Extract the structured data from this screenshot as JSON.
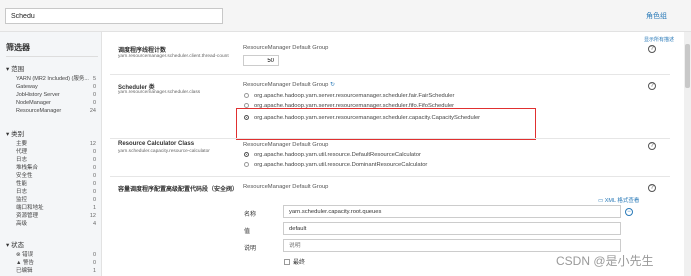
{
  "search": {
    "value": "Schedu"
  },
  "header": {
    "role_filter": "角色组"
  },
  "sidebar": {
    "title": "筛选器",
    "sections": [
      {
        "label": "范围",
        "items": [
          {
            "label": "YARN (MR2 Included) (服务...",
            "count": "5"
          },
          {
            "label": "Gateway",
            "count": "0"
          },
          {
            "label": "JobHistory Server",
            "count": "0"
          },
          {
            "label": "NodeManager",
            "count": "0"
          },
          {
            "label": "ResourceManager",
            "count": "24"
          }
        ]
      },
      {
        "label": "类别",
        "items": [
          {
            "label": "主要",
            "count": "12"
          },
          {
            "label": "代理",
            "count": "0"
          },
          {
            "label": "日志",
            "count": "0"
          },
          {
            "label": "堆栈集合",
            "count": "0"
          },
          {
            "label": "安全性",
            "count": "0"
          },
          {
            "label": "性能",
            "count": "0"
          },
          {
            "label": "日志",
            "count": "0"
          },
          {
            "label": "监控",
            "count": "0"
          },
          {
            "label": "端口和地址",
            "count": "1"
          },
          {
            "label": "资源管理",
            "count": "12"
          },
          {
            "label": "高级",
            "count": "4"
          }
        ]
      },
      {
        "label": "状态",
        "items": [
          {
            "label": "错误",
            "count": "0"
          },
          {
            "label": "警告",
            "count": "0"
          },
          {
            "label": "已编辑",
            "count": "1"
          }
        ]
      }
    ]
  },
  "main": {
    "show_all_desc": "显示所有描述",
    "properties": [
      {
        "title": "调度程序线程计数",
        "key": "yarn.resourcemanager.scheduler.client.thread-count",
        "group": "ResourceManager Default Group",
        "value": "50"
      },
      {
        "title": "Scheduler 类",
        "key": "yarn.resourcemanager.scheduler.class",
        "group": "ResourceManager Default Group",
        "options": [
          "org.apache.hadoop.yarn.server.resourcemanager.scheduler.fair.FairScheduler",
          "org.apache.hadoop.yarn.server.resourcemanager.scheduler.fifo.FifoScheduler",
          "org.apache.hadoop.yarn.server.resourcemanager.scheduler.capacity.CapacityScheduler"
        ],
        "selected": 2
      },
      {
        "title": "Resource Calculator Class",
        "key": "yarn.scheduler.capacity.resource-calculator",
        "group": "ResourceManager Default Group",
        "options": [
          "org.apache.hadoop.yarn.util.resource.DefaultResourceCalculator",
          "org.apache.hadoop.yarn.util.resource.DominantResourceCalculator"
        ],
        "selected": 0
      },
      {
        "title": "容量调度程序配置高级配置代码段（安全阀）",
        "group": "ResourceManager Default Group",
        "xml_view": "XML 格式查看",
        "fields": [
          {
            "label": "名称",
            "value": "yarn.scheduler.capacity.root.queues",
            "placeholder": ""
          },
          {
            "label": "值",
            "value": "default",
            "placeholder": ""
          },
          {
            "label": "说明",
            "value": "",
            "placeholder": "说明"
          }
        ],
        "final_label": "最终"
      }
    ]
  },
  "watermark": "CSDN @是小先生",
  "colors": {
    "highlight_box": "#e03030",
    "link": "#2a7ab8"
  }
}
